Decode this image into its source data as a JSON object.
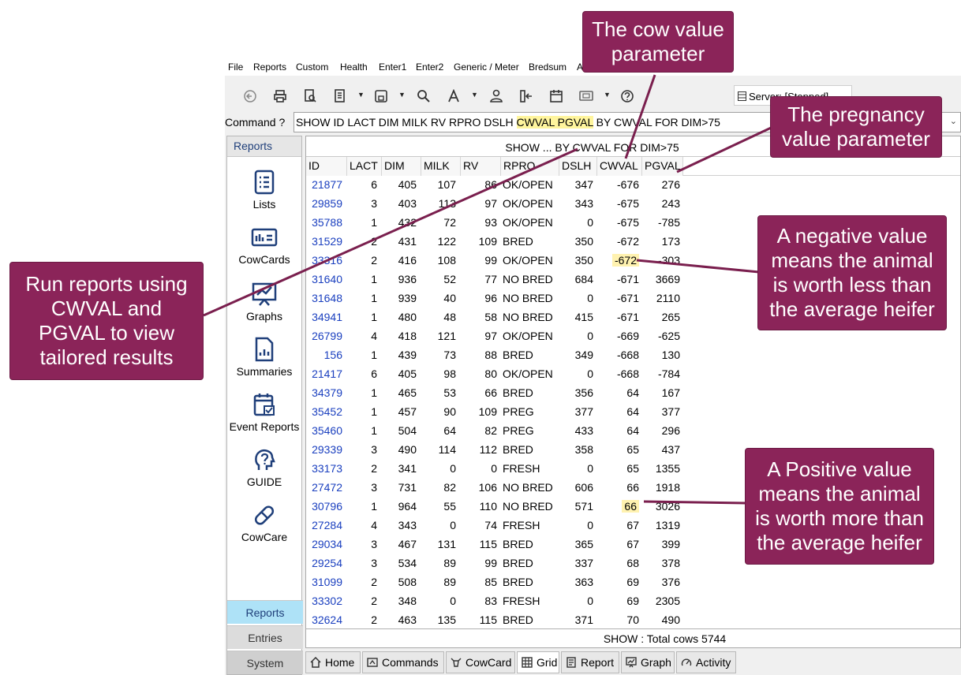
{
  "menu": [
    "File",
    "Reports",
    "Custom",
    "Health",
    "Enter1",
    "Enter2",
    "Generic / Meter",
    "Bredsum",
    "A"
  ],
  "server": {
    "label": "Server: [Stopped]"
  },
  "command": {
    "label": "Command ?",
    "value_prefix": "SHOW ID LACT DIM MILK RV RPRO DSLH ",
    "value_hl": "CWVAL PGVAL",
    "value_suffix": " BY CWVAL FOR DIM>75"
  },
  "nav": {
    "header": "Reports",
    "items": [
      "Lists",
      "CowCards",
      "Graphs",
      "Summaries",
      "Event Reports",
      "GUIDE",
      "CowCare"
    ],
    "buttons": [
      "Reports",
      "Entries",
      "System"
    ]
  },
  "grid": {
    "title": "SHOW ...  BY CWVAL FOR DIM>75",
    "columns": [
      "ID",
      "LACT",
      "DIM",
      "MILK",
      "RV",
      "RPRO",
      "DSLH",
      "CWVAL",
      "PGVAL"
    ],
    "rows": [
      [
        "21877",
        "6",
        "405",
        "107",
        "86",
        "OK/OPEN",
        "347",
        "-676",
        "276"
      ],
      [
        "29859",
        "3",
        "403",
        "113",
        "97",
        "OK/OPEN",
        "343",
        "-675",
        "243"
      ],
      [
        "35788",
        "1",
        "432",
        "72",
        "93",
        "OK/OPEN",
        "0",
        "-675",
        "-785"
      ],
      [
        "31529",
        "2",
        "431",
        "122",
        "109",
        "BRED",
        "350",
        "-672",
        "173"
      ],
      [
        "33316",
        "2",
        "416",
        "108",
        "99",
        "OK/OPEN",
        "350",
        "-672",
        "-303"
      ],
      [
        "31640",
        "1",
        "936",
        "52",
        "77",
        "NO BRED",
        "684",
        "-671",
        "3669"
      ],
      [
        "31648",
        "1",
        "939",
        "40",
        "96",
        "NO BRED",
        "0",
        "-671",
        "2110"
      ],
      [
        "34941",
        "1",
        "480",
        "48",
        "58",
        "NO BRED",
        "415",
        "-671",
        "265"
      ],
      [
        "26799",
        "4",
        "418",
        "121",
        "97",
        "OK/OPEN",
        "0",
        "-669",
        "-625"
      ],
      [
        "156",
        "1",
        "439",
        "73",
        "88",
        "BRED",
        "349",
        "-668",
        "130"
      ],
      [
        "21417",
        "6",
        "405",
        "98",
        "80",
        "OK/OPEN",
        "0",
        "-668",
        "-784"
      ],
      [
        "34379",
        "1",
        "465",
        "53",
        "66",
        "BRED",
        "356",
        "64",
        "167"
      ],
      [
        "35452",
        "1",
        "457",
        "90",
        "109",
        "PREG",
        "377",
        "64",
        "377"
      ],
      [
        "35460",
        "1",
        "504",
        "64",
        "82",
        "PREG",
        "433",
        "64",
        "296"
      ],
      [
        "29339",
        "3",
        "490",
        "114",
        "112",
        "BRED",
        "358",
        "65",
        "437"
      ],
      [
        "33173",
        "2",
        "341",
        "0",
        "0",
        "FRESH",
        "0",
        "65",
        "1355"
      ],
      [
        "27472",
        "3",
        "731",
        "82",
        "106",
        "NO BRED",
        "606",
        "66",
        "1918"
      ],
      [
        "30796",
        "1",
        "964",
        "55",
        "110",
        "NO BRED",
        "571",
        "66",
        "3026"
      ],
      [
        "27284",
        "4",
        "343",
        "0",
        "74",
        "FRESH",
        "0",
        "67",
        "1319"
      ],
      [
        "29034",
        "3",
        "467",
        "131",
        "115",
        "BRED",
        "365",
        "67",
        "399"
      ],
      [
        "29254",
        "3",
        "534",
        "89",
        "99",
        "BRED",
        "337",
        "68",
        "378"
      ],
      [
        "31099",
        "2",
        "508",
        "89",
        "85",
        "BRED",
        "363",
        "69",
        "376"
      ],
      [
        "33302",
        "2",
        "348",
        "0",
        "83",
        "FRESH",
        "0",
        "69",
        "2305"
      ],
      [
        "32624",
        "2",
        "463",
        "135",
        "115",
        "BRED",
        "371",
        "70",
        "490"
      ]
    ],
    "footer": "SHOW : Total cows  5744"
  },
  "tabs": [
    "Home",
    "Commands",
    "CowCard",
    "Grid",
    "Report",
    "Graph",
    "Activity"
  ],
  "callouts": {
    "cow_value": [
      "The cow value",
      "parameter"
    ],
    "pregnancy_value": [
      "The pregnancy",
      "value parameter"
    ],
    "run_reports": [
      "Run reports using",
      "CWVAL and",
      "PGVAL to view",
      "tailored results"
    ],
    "negative": [
      "A negative value",
      "means the animal",
      "is worth less than",
      "the average heifer"
    ],
    "positive": [
      "A Positive value",
      "means the animal",
      "is worth more than",
      "the average heifer"
    ]
  },
  "colors": {
    "callout_bg": "#8b2459",
    "id_link": "#1a3fbf",
    "highlight": "#fff59d"
  }
}
